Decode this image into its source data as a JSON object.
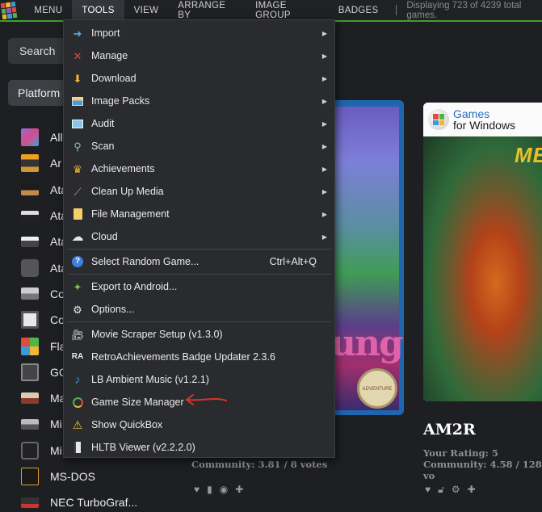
{
  "menubar": {
    "items": [
      "MENU",
      "TOOLS",
      "VIEW",
      "ARRANGE BY",
      "IMAGE GROUP",
      "BADGES"
    ],
    "status": "Displaying 723 of 4239 total games.",
    "accent_color": "#3f9e2e"
  },
  "sidebar": {
    "search_label": "Search",
    "filter_label": "Platform",
    "platforms": [
      {
        "label": "All",
        "icon": "all-platforms-icon"
      },
      {
        "label": "Ar",
        "icon": "arcade-icon"
      },
      {
        "label": "Ata",
        "icon": "atari-console-icon"
      },
      {
        "label": "Ata",
        "icon": "atari-console-icon"
      },
      {
        "label": "Ata",
        "icon": "atari-console-icon"
      },
      {
        "label": "Ata",
        "icon": "atari-console-icon"
      },
      {
        "label": "Co",
        "icon": "console-icon"
      },
      {
        "label": "Co",
        "icon": "computer-icon"
      },
      {
        "label": "Fla",
        "icon": "windows-icon"
      },
      {
        "label": "GC",
        "icon": "gamecube-icon"
      },
      {
        "label": "Ma",
        "icon": "console-icon"
      },
      {
        "label": "Mi",
        "icon": "console-icon"
      },
      {
        "label": "Mi",
        "icon": "xbox-icon"
      },
      {
        "label": "MS-DOS",
        "icon": "msdos-icon"
      },
      {
        "label": "NEC TurboGraf...",
        "icon": "turbografx-icon"
      }
    ]
  },
  "tools_menu": {
    "groups": [
      [
        {
          "label": "Import",
          "icon": "import-icon",
          "submenu": true
        },
        {
          "label": "Manage",
          "icon": "tools-icon",
          "submenu": true
        },
        {
          "label": "Download",
          "icon": "download-icon",
          "submenu": true
        },
        {
          "label": "Image Packs",
          "icon": "image-packs-icon",
          "submenu": true
        },
        {
          "label": "Audit",
          "icon": "audit-icon",
          "submenu": true
        },
        {
          "label": "Scan",
          "icon": "scan-icon",
          "submenu": true
        },
        {
          "label": "Achievements",
          "icon": "trophy-icon",
          "submenu": true
        },
        {
          "label": "Clean Up Media",
          "icon": "broom-icon",
          "submenu": true
        },
        {
          "label": "File Management",
          "icon": "folder-icon",
          "submenu": true
        },
        {
          "label": "Cloud",
          "icon": "cloud-icon",
          "submenu": true
        }
      ],
      [
        {
          "label": "Select Random Game...",
          "icon": "help-icon",
          "shortcut": "Ctrl+Alt+Q"
        }
      ],
      [
        {
          "label": "Export to Android...",
          "icon": "android-icon"
        },
        {
          "label": "Options...",
          "icon": "gear-icon"
        }
      ],
      [
        {
          "label": "Movie Scraper Setup (v1.3.0)",
          "icon": "movie-camera-icon"
        },
        {
          "label": "RetroAchievements Badge Updater 2.3.6",
          "icon": "ra-icon"
        },
        {
          "label": "LB Ambient Music (v1.2.1)",
          "icon": "music-note-icon"
        },
        {
          "label": "Game Size Manager",
          "icon": "game-size-icon"
        },
        {
          "label": "Show QuickBox",
          "icon": "warning-icon"
        },
        {
          "label": "HLTB Viewer (v2.2.2.0)",
          "icon": "hltb-icon"
        }
      ]
    ]
  },
  "games": {
    "left_card": {
      "box_text": "ung",
      "badge_text": "ADVENTURE",
      "community": "Community: 3.81 / 8 votes"
    },
    "right_card": {
      "publisher_line1": "Games",
      "publisher_line2": "for Windows",
      "box_text": "ME",
      "title": "AM2R",
      "your_rating": "Your Rating: 5",
      "community": "Community: 4.58 / 128 vo"
    }
  }
}
